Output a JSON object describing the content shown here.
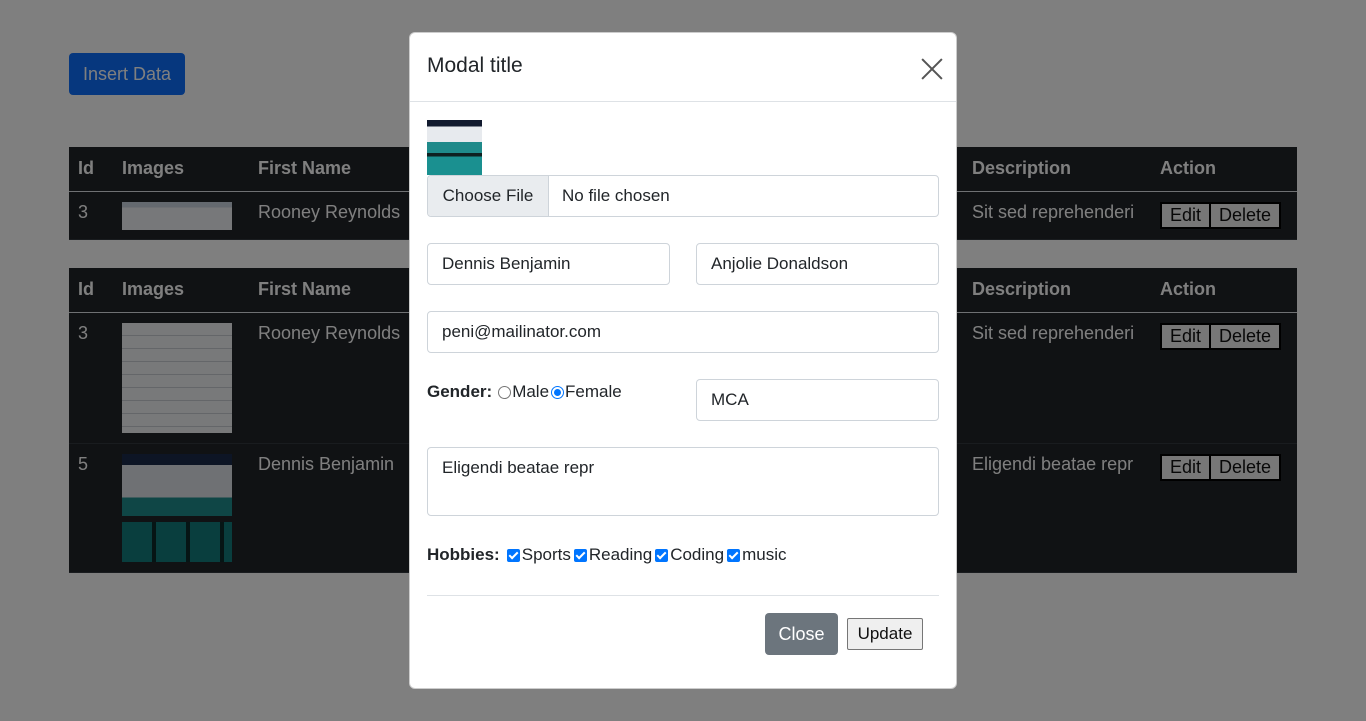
{
  "page": {
    "insert_button": "Insert Data"
  },
  "table": {
    "headers": [
      "Id",
      "Images",
      "First Name",
      "Description",
      "Action"
    ],
    "top_rows": [
      {
        "id": "3",
        "first_name": "Rooney Reynolds",
        "description": "Sit sed reprehenderi"
      }
    ],
    "rows": [
      {
        "id": "3",
        "first_name": "Rooney Reynolds",
        "description": "Sit sed reprehenderi"
      },
      {
        "id": "5",
        "first_name": "Dennis Benjamin",
        "description": "Eligendi beatae repr"
      }
    ],
    "edit_label": "Edit",
    "delete_label": "Delete"
  },
  "modal": {
    "title": "Modal title",
    "file_button": "Choose File",
    "file_status": "No file chosen",
    "first_name": "Dennis Benjamin",
    "last_name": "Anjolie Donaldson",
    "email": "peni@mailinator.com",
    "gender_label": "Gender:",
    "gender_options": [
      "Male",
      "Female"
    ],
    "gender_selected": "Female",
    "course": "MCA",
    "description": "Eligendi beatae repr",
    "hobbies_label": "Hobbies:",
    "hobbies": [
      "Sports",
      "Reading",
      "Coding",
      "music"
    ],
    "close_button": "Close",
    "update_button": "Update"
  },
  "colors": {
    "primary": "#0d6efd",
    "secondary": "#6c757d",
    "table_dark": "#212529",
    "check_blue": "#0075ff"
  }
}
